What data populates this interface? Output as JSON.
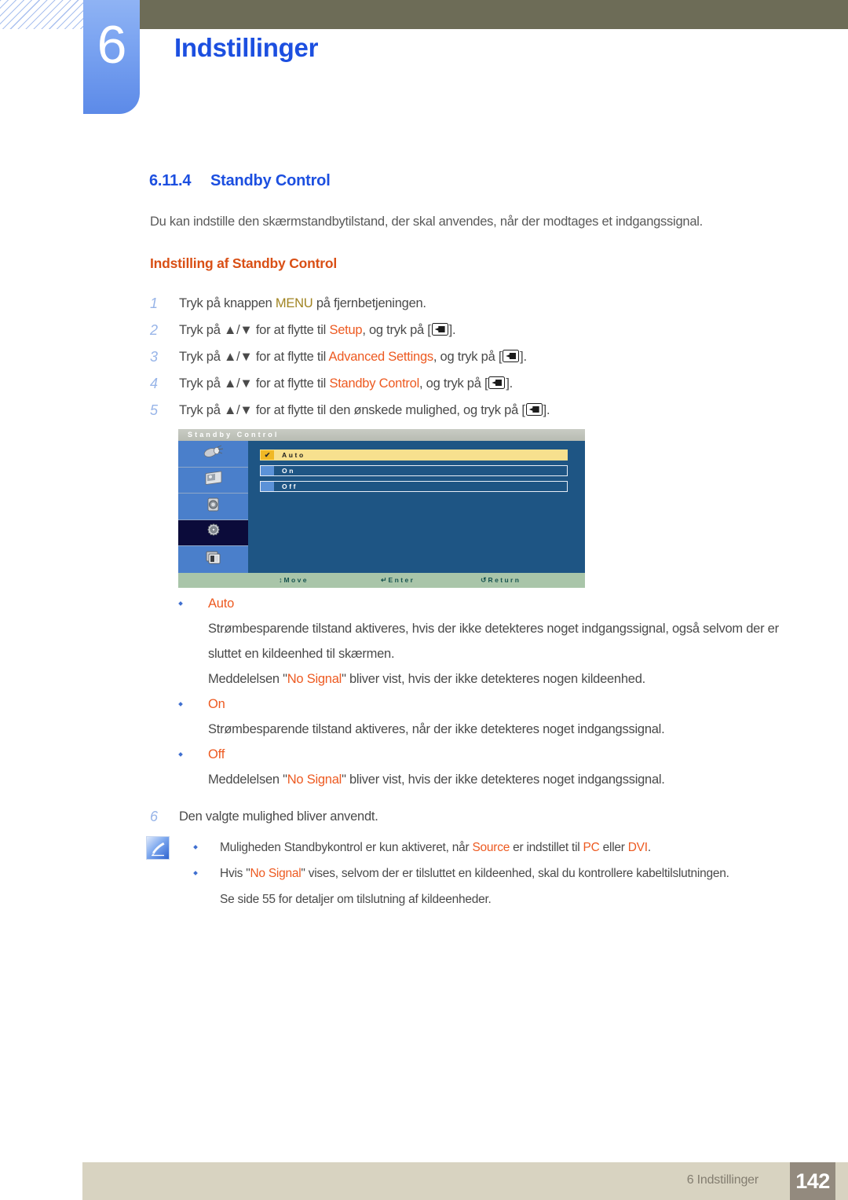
{
  "header": {
    "chapter_number": "6",
    "chapter_title": "Indstillinger"
  },
  "section": {
    "number": "6.11.4",
    "title": "Standby Control",
    "intro": "Du kan indstille den skærmstandbytilstand, der skal anvendes, når der modtages et indgangssignal.",
    "subheading": "Indstilling af Standby Control"
  },
  "steps": [
    {
      "num": "1",
      "pre": "Tryk på knappen ",
      "hl": "MENU",
      "hl_kind": "menu",
      "post": " på fjernbetjeningen.",
      "has_key": false
    },
    {
      "num": "2",
      "pre": "Tryk på ▲/▼ for at flytte til ",
      "hl": "Setup",
      "hl_kind": "orange",
      "post": ", og tryk på [",
      "tail": "].",
      "has_key": true
    },
    {
      "num": "3",
      "pre": "Tryk på ▲/▼ for at flytte til ",
      "hl": "Advanced Settings",
      "hl_kind": "orange",
      "post": ", og tryk på [",
      "tail": "].",
      "has_key": true
    },
    {
      "num": "4",
      "pre": "Tryk på ▲/▼ for at flytte til ",
      "hl": "Standby Control",
      "hl_kind": "orange",
      "post": ", og tryk på [",
      "tail": "].",
      "has_key": true
    },
    {
      "num": "5",
      "pre": "Tryk på ▲/▼ for at flytte til den ønskede mulighed, og tryk på [",
      "hl": "",
      "hl_kind": "none",
      "post": "",
      "tail": "].",
      "has_key": true
    }
  ],
  "osd": {
    "title": "Standby Control",
    "sidebar_icons": [
      "spotlight-icon",
      "picture-icon",
      "speaker-icon",
      "gear-icon",
      "multiscreen-icon"
    ],
    "selected_icon_index": 3,
    "options": [
      {
        "label": "Auto",
        "checked": true,
        "check_glyph": "✔"
      },
      {
        "label": "On",
        "checked": false,
        "check_glyph": ""
      },
      {
        "label": "Off",
        "checked": false,
        "check_glyph": ""
      }
    ],
    "footer": [
      {
        "glyph": "↕",
        "label": "Move"
      },
      {
        "glyph": "↵",
        "label": "Enter"
      },
      {
        "glyph": "↺",
        "label": "Return"
      }
    ]
  },
  "option_details": [
    {
      "name": "Auto",
      "lines": [
        {
          "text": "Strømbesparende tilstand aktiveres, hvis der ikke detekteres noget indgangssignal, også selvom der er sluttet en kildeenhed til skærmen.",
          "hl": null
        },
        {
          "pre": "Meddelelsen \"",
          "hl": "No Signal",
          "post": "\" bliver vist, hvis der ikke detekteres nogen kildeenhed."
        }
      ]
    },
    {
      "name": "On",
      "lines": [
        {
          "text": "Strømbesparende tilstand aktiveres, når der ikke detekteres noget indgangssignal.",
          "hl": null
        }
      ]
    },
    {
      "name": "Off",
      "lines": [
        {
          "pre": "Meddelelsen \"",
          "hl": "No Signal",
          "post": "\" bliver vist, hvis der ikke detekteres noget indgangssignal."
        }
      ]
    }
  ],
  "final_step": {
    "num": "6",
    "text": "Den valgte mulighed bliver anvendt."
  },
  "note": {
    "icon": "note-pen-icon",
    "bullet1": {
      "pre": "Muligheden Standbykontrol er kun aktiveret, når ",
      "hl1": "Source",
      "mid": " er indstillet til ",
      "hl2": "PC",
      "mid2": " eller ",
      "hl3": "DVI",
      "post": "."
    },
    "bullet2": {
      "pre": "Hvis \"",
      "hl": "No Signal",
      "post": "\" vises, selvom der er tilsluttet en kildeenhed, skal du kontrollere kabeltilslutningen."
    },
    "bullet2_sub": "Se side 55 for detaljer om tilslutning af kildeenheder."
  },
  "page_footer": {
    "label": "6 Indstillinger",
    "page_number": "142"
  },
  "colors": {
    "accent_blue": "#1c4fe0",
    "accent_orange": "#ed5a21",
    "menu_gold": "#a08321",
    "olive_bar": "#6d6c57",
    "footer_band": "#d8d3c1",
    "footer_num_box": "#938a7e",
    "osd_bg": "#1e5584",
    "osd_highlight": "#f7e08e"
  }
}
